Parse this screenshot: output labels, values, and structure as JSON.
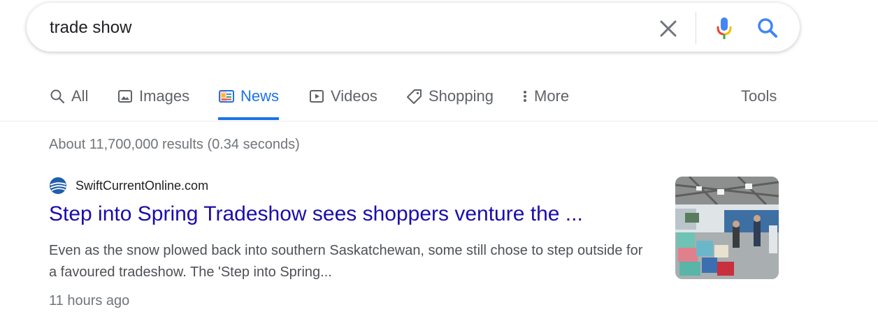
{
  "search": {
    "query": "trade show"
  },
  "tabs": [
    {
      "label": "All",
      "icon": "search-icon",
      "active": false
    },
    {
      "label": "Images",
      "icon": "image-icon",
      "active": false
    },
    {
      "label": "News",
      "icon": "news-icon",
      "active": true
    },
    {
      "label": "Videos",
      "icon": "play-icon",
      "active": false
    },
    {
      "label": "Shopping",
      "icon": "tag-icon",
      "active": false
    },
    {
      "label": "More",
      "icon": "more-vert-icon",
      "active": false
    }
  ],
  "tools_label": "Tools",
  "stats": "About 11,700,000 results (0.34 seconds)",
  "result": {
    "source": "SwiftCurrentOnline.com",
    "title": "Step into Spring Tradeshow sees shoppers venture the ...",
    "snippet": "Even as the snow plowed back into southern Saskatchewan, some still chose to step outside for a favoured tradeshow. The 'Step into Spring...",
    "time": "11 hours ago"
  },
  "colors": {
    "accent": "#1a73e8",
    "link": "#1a0dab",
    "muted": "#70757a"
  }
}
